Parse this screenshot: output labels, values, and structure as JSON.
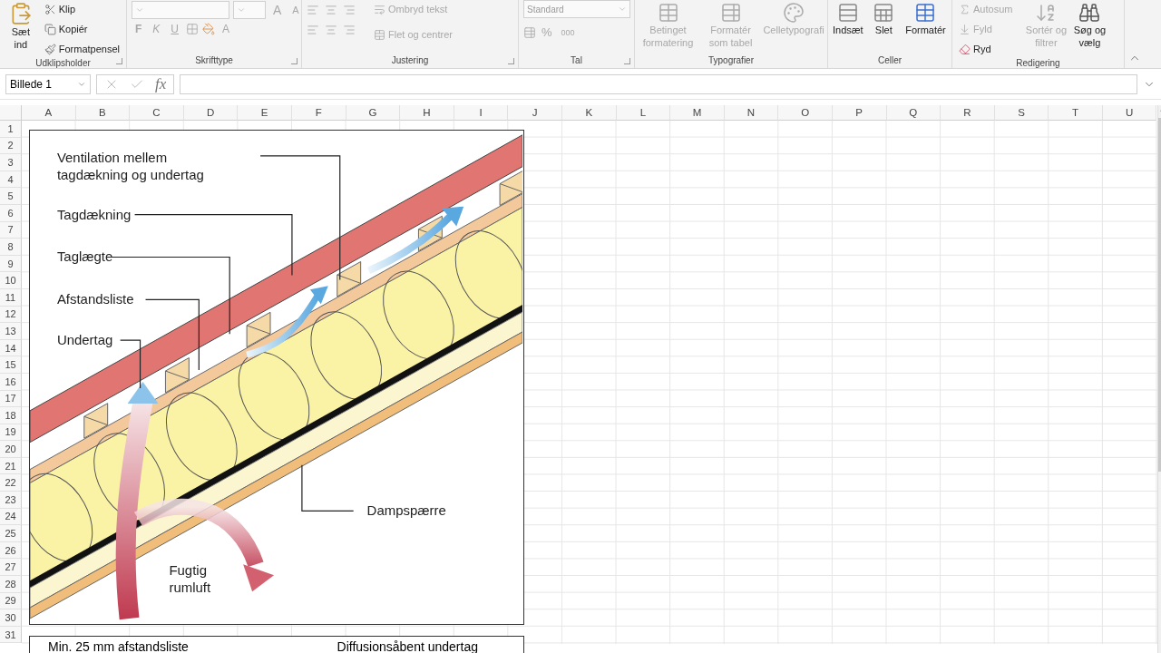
{
  "ribbon": {
    "clipboard": {
      "label": "Udklipsholder",
      "paste": {
        "label": "Sæt ind",
        "disabled": false
      },
      "commands": [
        {
          "label": "Klip",
          "disabled": false
        },
        {
          "label": "Kopiér",
          "disabled": false
        },
        {
          "label": "Formatpensel",
          "disabled": false
        }
      ]
    },
    "font": {
      "label": "Skrifttype",
      "glyphs": [
        {
          "label": "A",
          "disabled": true
        },
        {
          "label": "A",
          "disabled": true
        },
        {
          "label": "F",
          "disabled": true
        },
        {
          "label": "K",
          "disabled": true
        },
        {
          "label": "U",
          "disabled": true
        },
        {
          "label": "A",
          "disabled": true
        }
      ]
    },
    "alignment": {
      "label": "Justering",
      "commands": [
        {
          "label": "Ombryd tekst",
          "disabled": true
        },
        {
          "label": "Flet og centrer",
          "disabled": true
        }
      ]
    },
    "number": {
      "label": "Tal",
      "format": "Standard",
      "glyphs": [
        {
          "label": "%",
          "disabled": true
        },
        {
          "label": "000",
          "disabled": true
        }
      ]
    },
    "styles": {
      "label": "Typografier",
      "commands": [
        {
          "label": "Betinget formatering",
          "disabled": true
        },
        {
          "label": "Formatér som tabel",
          "disabled": true
        },
        {
          "label": "Celletypografi",
          "disabled": true
        }
      ]
    },
    "cells": {
      "label": "Celler",
      "commands": [
        {
          "label": "Indsæt",
          "disabled": false
        },
        {
          "label": "Slet",
          "disabled": false
        },
        {
          "label": "Formatér",
          "disabled": false
        }
      ]
    },
    "editing": {
      "label": "Redigering",
      "commands": [
        {
          "label": "Autosum",
          "disabled": true
        },
        {
          "label": "Fyld",
          "disabled": true
        },
        {
          "label": "Ryd",
          "disabled": false
        }
      ],
      "large": [
        {
          "label": "Sortér og filtrer",
          "disabled": true
        },
        {
          "label": "Søg og vælg",
          "disabled": false
        }
      ]
    }
  },
  "formula_bar": {
    "name_box": "Billede 1",
    "fx": "fx"
  },
  "sheet": {
    "columns": [
      "A",
      "B",
      "C",
      "D",
      "E",
      "F",
      "G",
      "H",
      "I",
      "J",
      "K",
      "L",
      "M",
      "N",
      "O",
      "P",
      "Q",
      "R",
      "S",
      "T",
      "U"
    ],
    "rows": [
      "1",
      "2",
      "3",
      "4",
      "5",
      "6",
      "7",
      "8",
      "9",
      "10",
      "11",
      "12",
      "13",
      "14",
      "15",
      "16",
      "17",
      "18",
      "19",
      "20",
      "21",
      "22",
      "23",
      "24",
      "25",
      "26",
      "27",
      "28",
      "29",
      "30",
      "31"
    ]
  },
  "picture": {
    "labels": {
      "ventilation": "Ventilation mellem tagdækning og undertag",
      "roofing": "Tagdækning",
      "batten": "Taglægte",
      "spacer": "Afstandsliste",
      "underlay": "Undertag",
      "vapor_barrier": "Dampspærre",
      "humid_air": "Fugtig rumluft"
    },
    "caption_box": [
      "Min. 25 mm afstandsliste",
      "Diffusionsåbent undertag"
    ]
  }
}
